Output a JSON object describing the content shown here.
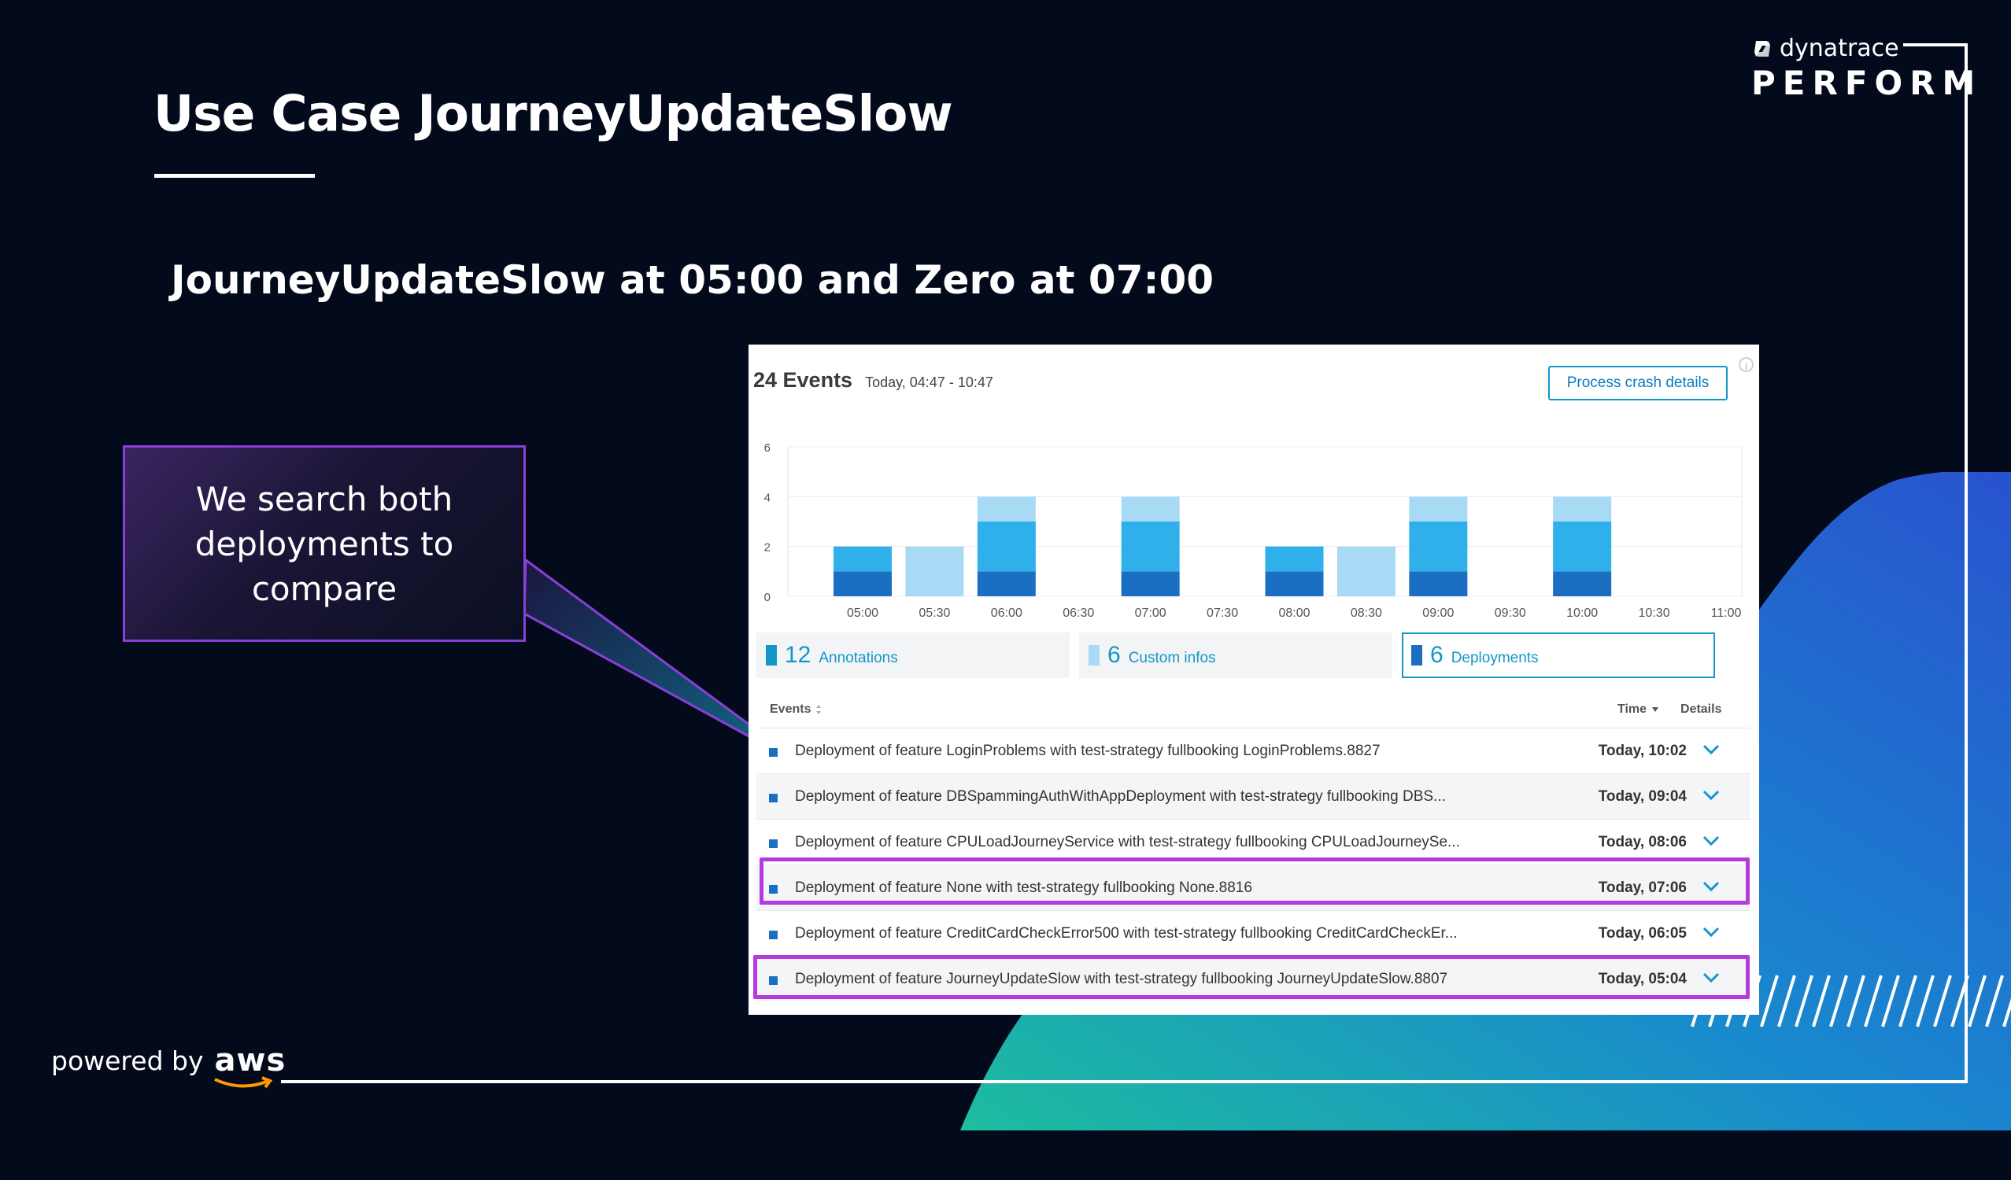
{
  "slide": {
    "title": "Use Case JourneyUpdateSlow",
    "subtitle": "JourneyUpdateSlow at 05:00 and Zero at 07:00",
    "brand_logo_text": "dynatrace",
    "brand_name": "PERFORM",
    "powered_by": "powered by",
    "aws": "aws"
  },
  "callout": {
    "text": "We search both deployments to compare"
  },
  "panel": {
    "events_count": "24 Events",
    "time_range": "Today, 04:47 - 10:47",
    "process_crash_button": "Process crash details",
    "tabs": [
      {
        "count": "12",
        "label": "Annotations",
        "color": "#1496c9"
      },
      {
        "count": "6",
        "label": "Custom infos",
        "color": "#a8daf5"
      },
      {
        "count": "6",
        "label": "Deployments",
        "color": "#1a6fc2"
      }
    ],
    "columns": {
      "events": "Events",
      "time": "Time",
      "details": "Details"
    },
    "rows": [
      {
        "text": "Deployment of feature LoginProblems with test-strategy fullbooking LoginProblems.8827",
        "time": "Today, 10:02",
        "highlighted": false
      },
      {
        "text": "Deployment of feature DBSpammingAuthWithAppDeployment with test-strategy fullbooking DBS...",
        "time": "Today, 09:04",
        "highlighted": false
      },
      {
        "text": "Deployment of feature CPULoadJourneyService with test-strategy fullbooking CPULoadJourneySe...",
        "time": "Today, 08:06",
        "highlighted": false
      },
      {
        "text": "Deployment of feature None with test-strategy fullbooking None.8816",
        "time": "Today, 07:06",
        "highlighted": true
      },
      {
        "text": "Deployment of feature CreditCardCheckError500 with test-strategy fullbooking CreditCardCheckEr...",
        "time": "Today, 06:05",
        "highlighted": false
      },
      {
        "text": "Deployment of feature JourneyUpdateSlow with test-strategy fullbooking JourneyUpdateSlow.8807",
        "time": "Today, 05:04",
        "highlighted": true
      }
    ]
  },
  "colors": {
    "deployments": "#1a6fc2",
    "annotations": "#2fb0ea",
    "custom_infos": "#a8daf5",
    "highlight": "#b43cdc",
    "accent": "#1496c9"
  },
  "chart_data": {
    "type": "bar",
    "stacked": true,
    "categories": [
      "05:00",
      "05:30",
      "06:00",
      "06:30",
      "07:00",
      "07:30",
      "08:00",
      "08:30",
      "09:00",
      "09:30",
      "10:00",
      "10:30",
      "11:00"
    ],
    "series": [
      {
        "name": "Deployments",
        "color": "#1a6fc2",
        "values": [
          1,
          0,
          1,
          0,
          1,
          0,
          1,
          0,
          1,
          0,
          1,
          0,
          0
        ]
      },
      {
        "name": "Annotations",
        "color": "#2fb0ea",
        "values": [
          1,
          0,
          2,
          0,
          2,
          0,
          1,
          0,
          2,
          0,
          2,
          0,
          0
        ]
      },
      {
        "name": "Custom infos",
        "color": "#a8daf5",
        "values": [
          0,
          2,
          1,
          0,
          1,
          0,
          0,
          2,
          1,
          0,
          1,
          0,
          0
        ]
      }
    ],
    "yticks": [
      0,
      2,
      4,
      6
    ],
    "ylim": [
      0,
      6
    ],
    "grid": true
  }
}
